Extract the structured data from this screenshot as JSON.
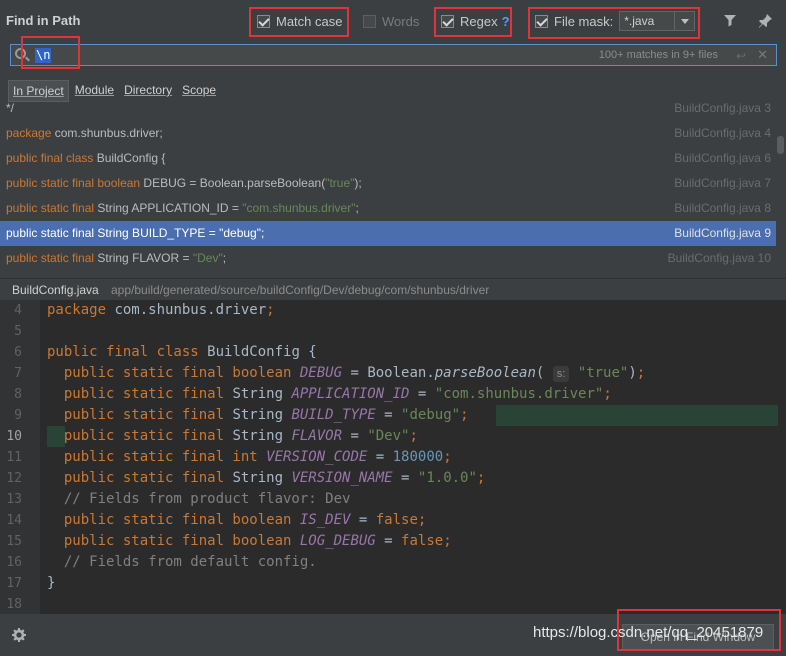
{
  "dialog": {
    "title": "Find in Path"
  },
  "options": {
    "match_case": "Match case",
    "words": "Words",
    "regex": "Regex",
    "regex_help": "?",
    "file_mask_label": "File mask:",
    "file_mask_value": "*.java"
  },
  "search": {
    "value": "\\n",
    "match_count": "100+ matches in 9+ files"
  },
  "scope_tabs": [
    "In Project",
    "Module",
    "Directory",
    "Scope"
  ],
  "results": [
    {
      "parts": [
        {
          "t": "*/",
          "c": "pl"
        }
      ],
      "file": "BuildConfig.java 3"
    },
    {
      "parts": [
        {
          "t": "package",
          "c": "kw"
        },
        {
          "t": " com.shunbus.driver;",
          "c": "pl"
        }
      ],
      "file": "BuildConfig.java 4"
    },
    {
      "parts": [
        {
          "t": "public final class",
          "c": "kw"
        },
        {
          "t": " BuildConfig {",
          "c": "pl"
        }
      ],
      "file": "BuildConfig.java 6"
    },
    {
      "parts": [
        {
          "t": "public static final boolean",
          "c": "kw"
        },
        {
          "t": " DEBUG = Boolean.parseBoolean(",
          "c": "pl"
        },
        {
          "t": "\"true\"",
          "c": "str"
        },
        {
          "t": ");",
          "c": "pl"
        }
      ],
      "file": "BuildConfig.java 7"
    },
    {
      "parts": [
        {
          "t": "public static final",
          "c": "kw"
        },
        {
          "t": " String APPLICATION_ID = ",
          "c": "pl"
        },
        {
          "t": "\"com.shunbus.driver\"",
          "c": "str"
        },
        {
          "t": ";",
          "c": "pl"
        }
      ],
      "file": "BuildConfig.java 8"
    },
    {
      "parts": [
        {
          "t": "public static final String BUILD_TYPE = \"debug\";",
          "c": "pl"
        }
      ],
      "file": "BuildConfig.java 9",
      "selected": true
    },
    {
      "parts": [
        {
          "t": "public static final",
          "c": "kw"
        },
        {
          "t": " String FLAVOR = ",
          "c": "pl"
        },
        {
          "t": "\"Dev\"",
          "c": "str"
        },
        {
          "t": ";",
          "c": "pl"
        }
      ],
      "file": "BuildConfig.java 10"
    }
  ],
  "path_bar": {
    "file": "BuildConfig.java",
    "dir": "app/build/generated/source/buildConfig/Dev/debug/com/shunbus/driver"
  },
  "editor": {
    "current_line": "10",
    "lines": [
      {
        "n": "4",
        "parts": [
          {
            "t": "package ",
            "c": "ed-kw"
          },
          {
            "t": "com.shunbus.driver",
            "c": ""
          },
          {
            "t": ";",
            "c": "ed-kw"
          }
        ]
      },
      {
        "n": "5",
        "parts": []
      },
      {
        "n": "6",
        "parts": [
          {
            "t": "public final class ",
            "c": "ed-kw"
          },
          {
            "t": "BuildConfig {",
            "c": ""
          }
        ]
      },
      {
        "n": "7",
        "parts": [
          {
            "t": "  public static final boolean ",
            "c": "ed-kw"
          },
          {
            "t": "DEBUG",
            "c": "ed-field"
          },
          {
            "t": " = Boolean.",
            "c": ""
          },
          {
            "t": "parseBoolean",
            "c": "ed-method"
          },
          {
            "t": "( ",
            "c": ""
          },
          {
            "t": "s:",
            "c": "hint"
          },
          {
            "t": " ",
            "c": ""
          },
          {
            "t": "\"true\"",
            "c": "ed-str"
          },
          {
            "t": ")",
            "c": ""
          },
          {
            "t": ";",
            "c": "ed-kw"
          }
        ]
      },
      {
        "n": "8",
        "parts": [
          {
            "t": "  public static final ",
            "c": "ed-kw"
          },
          {
            "t": "String ",
            "c": ""
          },
          {
            "t": "APPLICATION_ID",
            "c": "ed-field"
          },
          {
            "t": " = ",
            "c": ""
          },
          {
            "t": "\"com.shunbus.driver\"",
            "c": "ed-str"
          },
          {
            "t": ";",
            "c": "ed-kw"
          }
        ]
      },
      {
        "n": "9",
        "parts": [
          {
            "t": "  public static final ",
            "c": "ed-kw"
          },
          {
            "t": "String ",
            "c": ""
          },
          {
            "t": "BUILD_TYPE",
            "c": "ed-field"
          },
          {
            "t": " = ",
            "c": ""
          },
          {
            "t": "\"debug\"",
            "c": "ed-str"
          },
          {
            "t": ";",
            "c": "ed-kw"
          }
        ]
      },
      {
        "n": "10",
        "parts": [
          {
            "t": "  public static final ",
            "c": "ed-kw"
          },
          {
            "t": "String ",
            "c": ""
          },
          {
            "t": "FLAVOR",
            "c": "ed-field"
          },
          {
            "t": " = ",
            "c": ""
          },
          {
            "t": "\"Dev\"",
            "c": "ed-str"
          },
          {
            "t": ";",
            "c": "ed-kw"
          }
        ]
      },
      {
        "n": "11",
        "parts": [
          {
            "t": "  public static final int ",
            "c": "ed-kw"
          },
          {
            "t": "VERSION_CODE",
            "c": "ed-field"
          },
          {
            "t": " = ",
            "c": ""
          },
          {
            "t": "180000",
            "c": "ed-num"
          },
          {
            "t": ";",
            "c": "ed-kw"
          }
        ]
      },
      {
        "n": "12",
        "parts": [
          {
            "t": "  public static final ",
            "c": "ed-kw"
          },
          {
            "t": "String ",
            "c": ""
          },
          {
            "t": "VERSION_NAME",
            "c": "ed-field"
          },
          {
            "t": " = ",
            "c": ""
          },
          {
            "t": "\"1.0.0\"",
            "c": "ed-str"
          },
          {
            "t": ";",
            "c": "ed-kw"
          }
        ]
      },
      {
        "n": "13",
        "parts": [
          {
            "t": "  // Fields from product flavor: Dev",
            "c": "ed-cmt"
          }
        ]
      },
      {
        "n": "14",
        "parts": [
          {
            "t": "  public static final boolean ",
            "c": "ed-kw"
          },
          {
            "t": "IS_DEV",
            "c": "ed-field"
          },
          {
            "t": " = ",
            "c": ""
          },
          {
            "t": "false",
            "c": "ed-kw"
          },
          {
            "t": ";",
            "c": "ed-kw"
          }
        ]
      },
      {
        "n": "15",
        "parts": [
          {
            "t": "  public static final boolean ",
            "c": "ed-kw"
          },
          {
            "t": "LOG_DEBUG",
            "c": "ed-field"
          },
          {
            "t": " = ",
            "c": ""
          },
          {
            "t": "false",
            "c": "ed-kw"
          },
          {
            "t": ";",
            "c": "ed-kw"
          }
        ]
      },
      {
        "n": "16",
        "parts": [
          {
            "t": "  // Fields from default config.",
            "c": "ed-cmt"
          }
        ]
      },
      {
        "n": "17",
        "parts": [
          {
            "t": "}",
            "c": ""
          }
        ]
      },
      {
        "n": "18",
        "parts": []
      }
    ]
  },
  "footer": {
    "open_button": "Open in Find Window"
  },
  "watermark": "https://blog.csdn.net/qq_20451879",
  "colors": {
    "accent": "#4b6eaf",
    "highlight_box": "#e0343a"
  },
  "icons": [
    "filter-icon",
    "pin-icon",
    "search-icon",
    "settings-icon"
  ]
}
